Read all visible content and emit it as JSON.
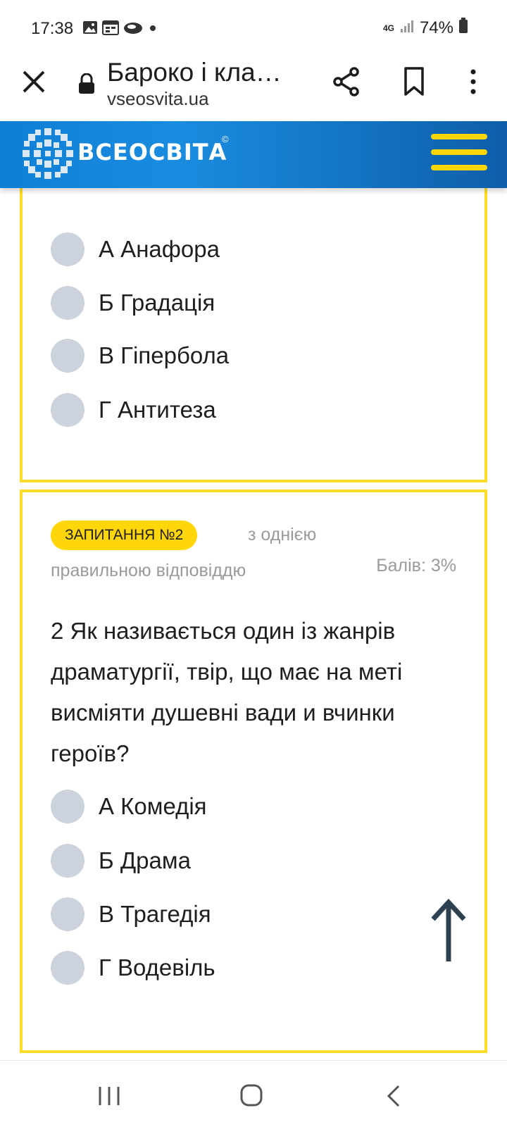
{
  "status_bar": {
    "time": "17:38",
    "network": "4G",
    "battery": "74%",
    "icons": [
      "gallery-icon",
      "calendar-icon",
      "cloud-icon",
      "dot-icon",
      "signal-icon",
      "battery-icon"
    ]
  },
  "browser": {
    "page_title": "Бароко і кла…",
    "url": "vseosvita.ua",
    "icons": [
      "close-icon",
      "lock-icon",
      "share-icon",
      "bookmark-icon",
      "more-icon"
    ]
  },
  "site": {
    "logo_text": "ВСЕОСВІТА",
    "logo_mark": "©",
    "brand_colors": {
      "header_blue": "#1a8ce0",
      "accent_yellow": "#ffd60a",
      "border_yellow": "#ffdc2a"
    }
  },
  "question_1": {
    "options": [
      "А Анафора",
      "Б Градація",
      "В Гіпербола",
      "Г Антитеза"
    ]
  },
  "question_2": {
    "badge": "ЗАПИТАННЯ №2",
    "type_line1": "з однією",
    "type_line2": "правильною відповіддю",
    "score": "Балів: 3%",
    "text": "2 Як називається один із жанрів драматургії, твір, що має на меті висміяти душевні вади и вчинки героїв?",
    "options": [
      "А Комедія",
      "Б Драма",
      "В Трагедія",
      "Г Водевіль"
    ]
  },
  "nav": {
    "icons": [
      "recent-apps-icon",
      "home-icon",
      "back-icon"
    ]
  }
}
